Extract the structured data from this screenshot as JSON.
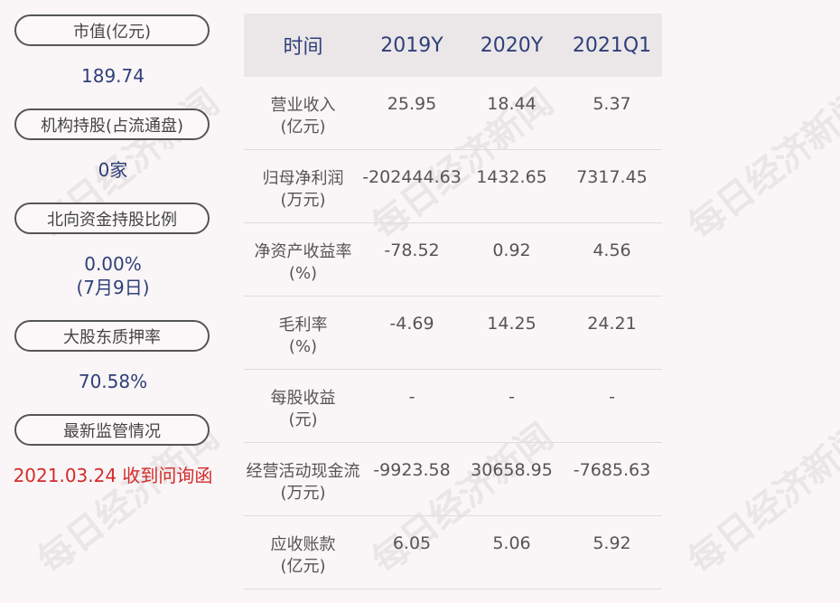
{
  "left": {
    "items": [
      {
        "label": "市值(亿元)",
        "value": "189.74"
      },
      {
        "label": "机构持股(占流通盘)",
        "value": "0家"
      },
      {
        "label": "北向资金持股比例",
        "value": "0.00%",
        "value2": "(7月9日)"
      },
      {
        "label": "大股东质押率",
        "value": "70.58%"
      },
      {
        "label": "最新监管情况",
        "value": "2021.03.24 收到问询函"
      }
    ]
  },
  "table": {
    "headers": [
      "时间",
      "2019Y",
      "2020Y",
      "2021Q1"
    ],
    "rows": [
      {
        "label1": "营业收入",
        "label2": "(亿元)",
        "cells": [
          "25.95",
          "18.44",
          "5.37"
        ]
      },
      {
        "label1": "归母净利润",
        "label2": "(万元)",
        "cells": [
          "-202444.63",
          "1432.65",
          "7317.45"
        ]
      },
      {
        "label1": "净资产收益率",
        "label2": "(%)",
        "cells": [
          "-78.52",
          "0.92",
          "4.56"
        ]
      },
      {
        "label1": "毛利率",
        "label2": "(%)",
        "cells": [
          "-4.69",
          "14.25",
          "24.21"
        ]
      },
      {
        "label1": "每股收益",
        "label2": "(元)",
        "cells": [
          "-",
          "-",
          "-"
        ]
      },
      {
        "label1": "经营活动现金流",
        "label2": "(万元)",
        "cells": [
          "-9923.58",
          "30658.95",
          "-7685.63"
        ]
      },
      {
        "label1": "应收账款",
        "label2": "(亿元)",
        "cells": [
          "6.05",
          "5.06",
          "5.92"
        ]
      }
    ]
  },
  "watermark": "每日经济新闻",
  "colors": {
    "accent": "#2f3f7a",
    "alert": "#d42b2b",
    "header_bg": "#ebe7e8"
  }
}
